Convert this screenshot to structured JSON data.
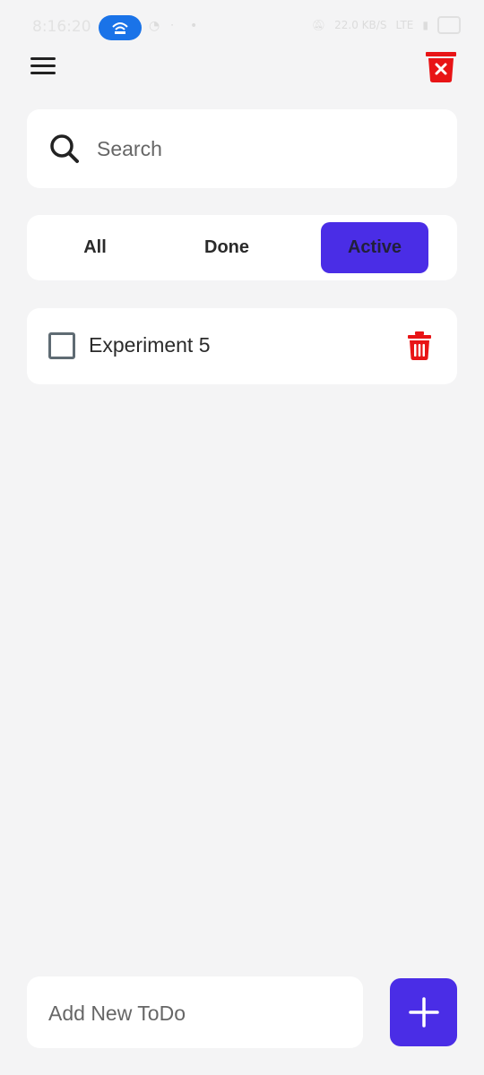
{
  "status_bar": {
    "time": "8:16:20",
    "network_speed": "22.0 KB/S",
    "network_type": "LTE",
    "hotspot_color": "#1a73e8"
  },
  "header": {
    "menu_icon": "hamburger-menu-icon",
    "clear_icon": "trash-x-icon"
  },
  "search": {
    "placeholder": "Search",
    "value": ""
  },
  "filters": {
    "tabs": [
      {
        "label": "All",
        "selected": false
      },
      {
        "label": "Done",
        "selected": false
      },
      {
        "label": "Active",
        "selected": true
      }
    ],
    "accent_color": "#4a2de6"
  },
  "todos": [
    {
      "text": "Experiment 5",
      "done": false,
      "delete_icon": "trash-icon"
    }
  ],
  "add_todo": {
    "placeholder": "Add New ToDo",
    "value": "",
    "button_icon": "plus-icon"
  },
  "colors": {
    "background": "#f4f4f5",
    "card": "#ffffff",
    "danger": "#e81416",
    "accent": "#4a2de6"
  }
}
